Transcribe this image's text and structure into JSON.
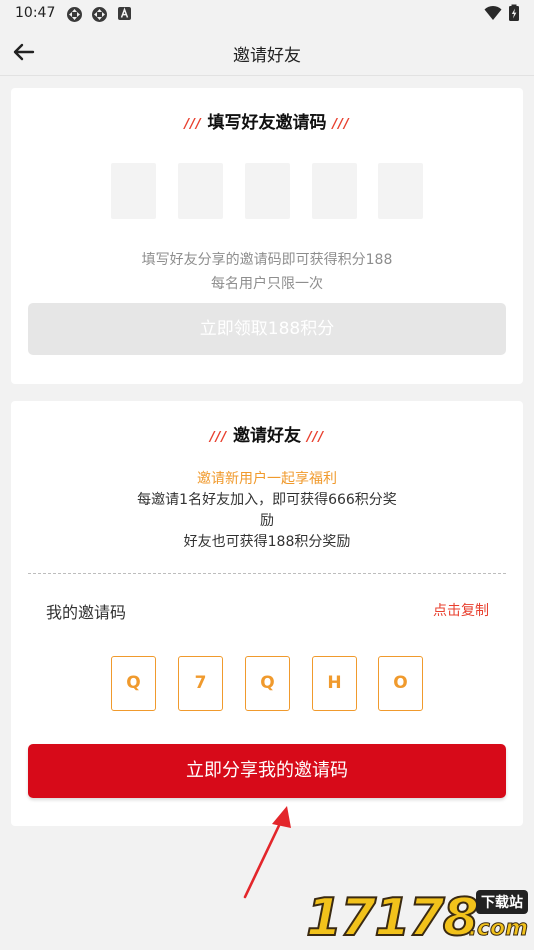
{
  "status_bar": {
    "time": "10:47",
    "left_icons": [
      "sync-icon",
      "sync-icon",
      "notification-a-icon"
    ],
    "right_icons": [
      "wifi-icon",
      "battery-icon"
    ]
  },
  "app_bar": {
    "back_icon": "arrow-left-icon",
    "title": "邀请好友"
  },
  "enter_code_card": {
    "title": "填写好友邀请码",
    "deco": "///",
    "code_boxes": [
      "",
      "",
      "",
      "",
      ""
    ],
    "hint_line1": "填写好友分享的邀请码即可获得积分188",
    "hint_line2": "每名用户只限一次",
    "claim_button": "立即领取188积分"
  },
  "invite_card": {
    "title": "邀请好友",
    "deco": "///",
    "promo_accent": "邀请新用户一起享福利",
    "promo_line1": "每邀请1名好友加入，即可获得666积分奖",
    "promo_line2": "励",
    "promo_line3": "好友也可获得188积分奖励",
    "my_code_label": "我的邀请码",
    "copy_link": "点击复制",
    "my_code": [
      "Q",
      "7",
      "Q",
      "H",
      "O"
    ],
    "share_button": "立即分享我的邀请码"
  },
  "watermark": {
    "number": "17178",
    "tag": "下载站",
    "domain": ".com"
  },
  "colors": {
    "accent_red": "#d70a19",
    "accent_orange": "#f09a2d",
    "deco_red": "#e8402f",
    "background": "#f2f2f2"
  }
}
